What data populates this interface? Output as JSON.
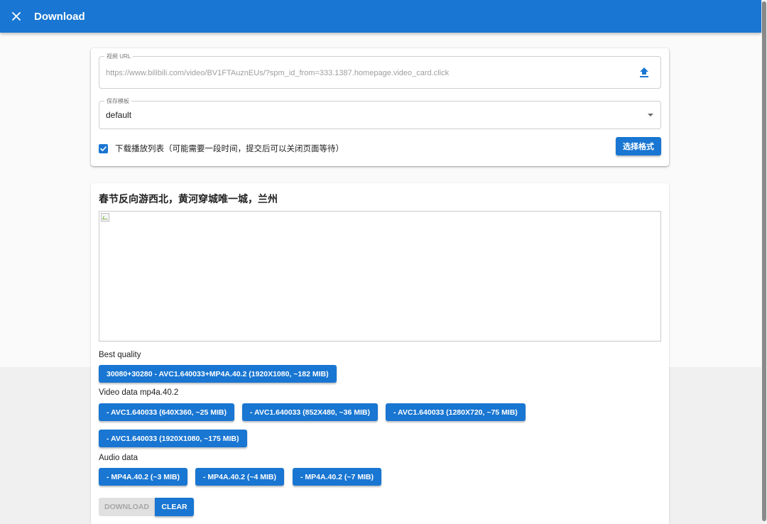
{
  "appbar": {
    "title": "Download"
  },
  "form": {
    "url_label": "视频 URL",
    "url_placeholder": "https://www.bilibili.com/video/BV1FTAuznEUs/?spm_id_from=333.1387.homepage.video_card.click",
    "url_value": "",
    "template_label": "保存模板",
    "template_value": "default",
    "playlist_checked": true,
    "playlist_label": "下载播放列表（可能需要一段时间，提交后可以关闭页面等待）",
    "select_format_label": "选择格式"
  },
  "video": {
    "title": "春节反向游西北，黄河穿城唯一城，兰州",
    "best_quality_label": "Best quality",
    "best_quality_formats": [
      "30080+30280 - AVC1.640033+MP4A.40.2 (1920X1080, ~182 MIB)"
    ],
    "video_data_label": "Video data mp4a.40.2",
    "video_formats": [
      "- AVC1.640033 (640X360, ~25 MIB)",
      "- AVC1.640033 (852X480, ~36 MIB)",
      "- AVC1.640033 (1280X720, ~75 MIB)",
      "- AVC1.640033 (1920X1080, ~175 MIB)"
    ],
    "audio_data_label": "Audio data",
    "audio_formats": [
      "- MP4A.40.2 (~3 MIB)",
      "- MP4A.40.2 (~4 MIB)",
      "- MP4A.40.2 (~7 MIB)"
    ]
  },
  "actions": {
    "download_label": "DOWNLOAD",
    "clear_label": "CLEAR"
  },
  "icons": {
    "close": "close-icon",
    "upload": "upload-icon",
    "dropdown": "chevron-down-icon",
    "checkbox": "check-icon"
  },
  "colors": {
    "primary": "#1976d2",
    "disabled_bg": "#e0e0e0",
    "disabled_text": "#a6a6a6"
  }
}
